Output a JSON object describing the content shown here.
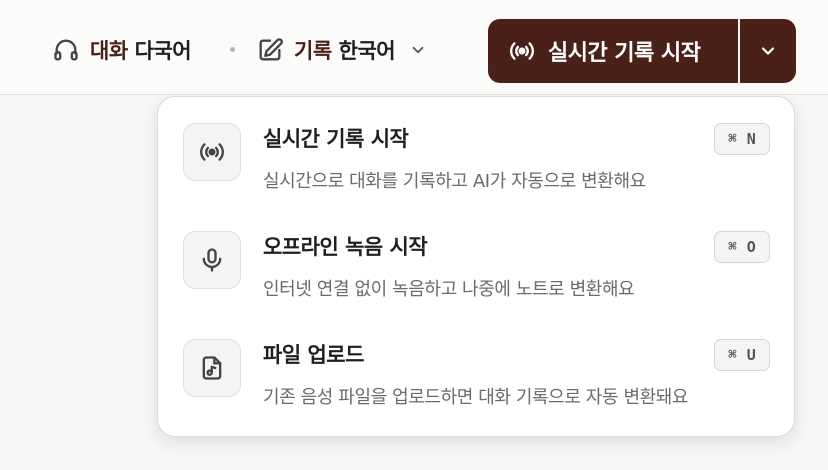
{
  "topbar": {
    "conversation": {
      "label": "대화",
      "value": "다국어",
      "icon": "headset-icon"
    },
    "record": {
      "label": "기록",
      "value": "한국어",
      "icon": "edit-icon"
    },
    "start_button": {
      "label": "실시간 기록 시작",
      "icon": "broadcast-icon"
    },
    "dropdown_icon": "chevron-down-icon"
  },
  "menu": {
    "items": [
      {
        "title": "실시간 기록 시작",
        "description": "실시간으로 대화를 기록하고 AI가 자동으로 변환해요",
        "shortcut_mod": "⌘",
        "shortcut_key": "N",
        "icon": "broadcast-icon"
      },
      {
        "title": "오프라인 녹음 시작",
        "description": "인터넷 연결 없이 녹음하고 나중에 노트로 변환해요",
        "shortcut_mod": "⌘",
        "shortcut_key": "O",
        "icon": "microphone-icon"
      },
      {
        "title": "파일 업로드",
        "description": "기존 음성 파일을 업로드하면 대화 기록으로 자동 변환돼요",
        "shortcut_mod": "⌘",
        "shortcut_key": "U",
        "icon": "audio-file-icon"
      }
    ]
  },
  "colors": {
    "accent": "#4a2119",
    "muted_text": "#6e6a66"
  }
}
